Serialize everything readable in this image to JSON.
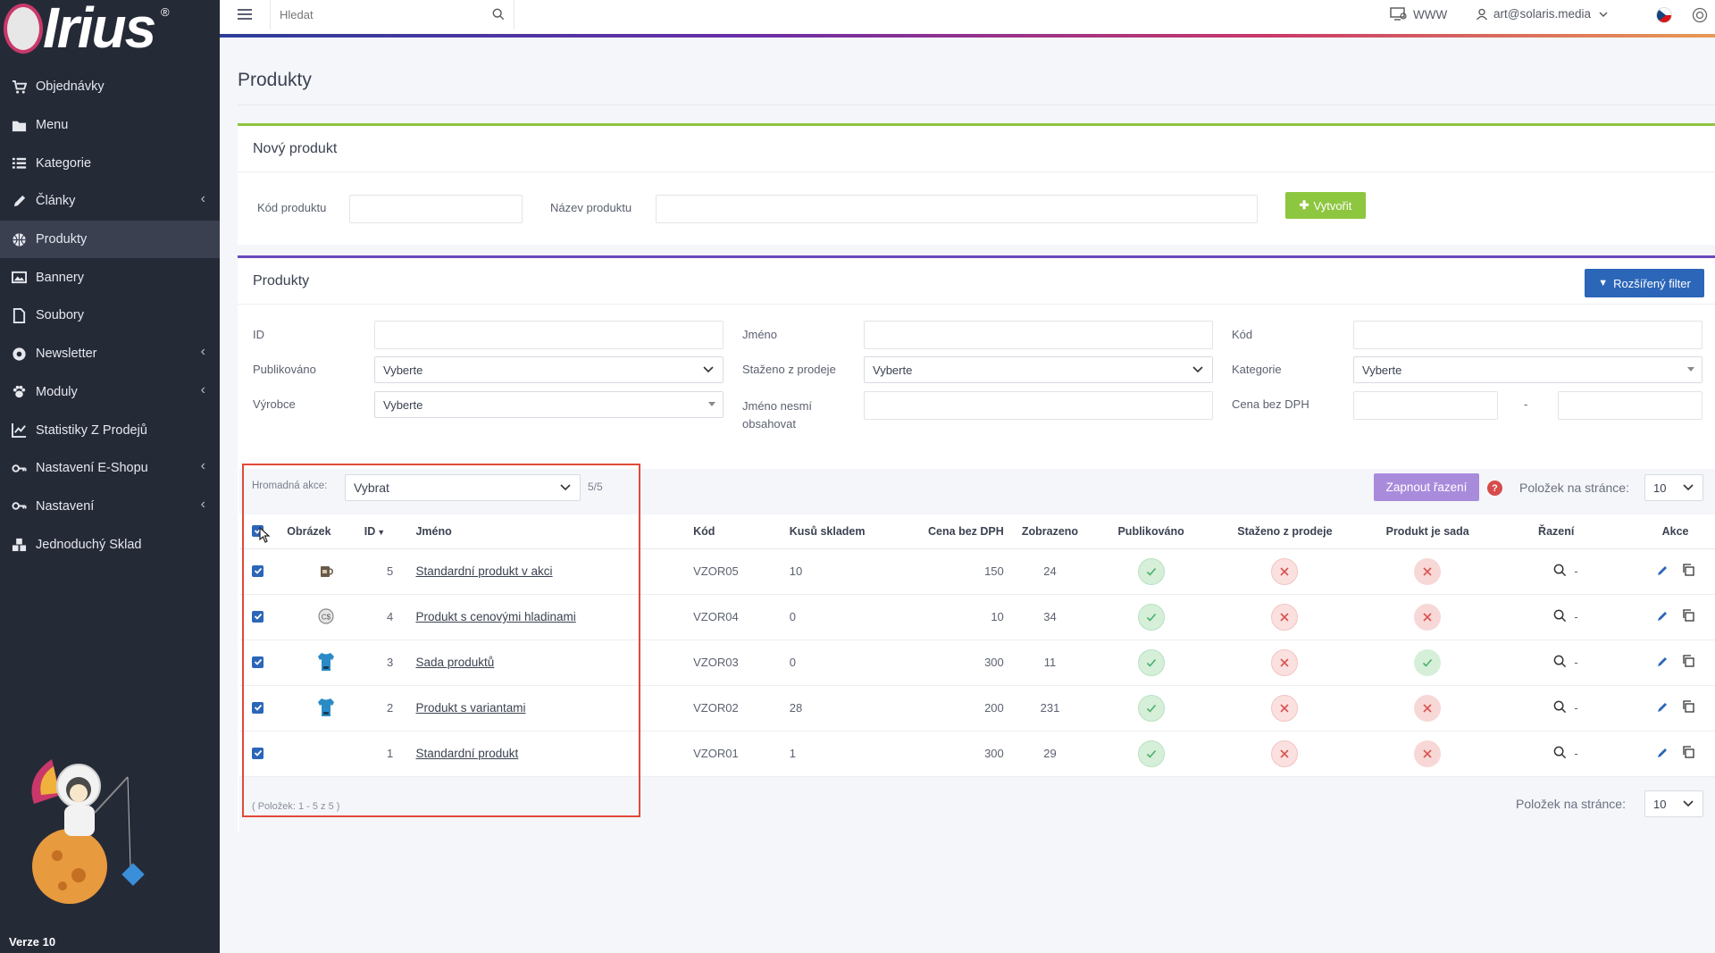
{
  "app": {
    "logo_text": "Irius",
    "version": "Verze 10"
  },
  "sidebar": {
    "items": [
      {
        "label": "Objednávky",
        "icon": "cart-icon",
        "arrow": false,
        "active": false
      },
      {
        "label": "Menu",
        "icon": "folder-icon",
        "arrow": false,
        "active": false
      },
      {
        "label": "Kategorie",
        "icon": "list-icon",
        "arrow": false,
        "active": false
      },
      {
        "label": "Články",
        "icon": "pencil-icon",
        "arrow": true,
        "active": false
      },
      {
        "label": "Produkty",
        "icon": "basketball-icon",
        "arrow": false,
        "active": true
      },
      {
        "label": "Bannery",
        "icon": "image-icon",
        "arrow": false,
        "active": false
      },
      {
        "label": "Soubory",
        "icon": "file-icon",
        "arrow": false,
        "active": false
      },
      {
        "label": "Newsletter",
        "icon": "at-icon",
        "arrow": true,
        "active": false
      },
      {
        "label": "Moduly",
        "icon": "paw-icon",
        "arrow": true,
        "active": false
      },
      {
        "label": "Statistiky Z Prodejů",
        "icon": "chart-line-icon",
        "arrow": false,
        "active": false
      },
      {
        "label": "Nastavení E-Shopu",
        "icon": "key-icon",
        "arrow": true,
        "active": false
      },
      {
        "label": "Nastavení",
        "icon": "key-icon",
        "arrow": true,
        "active": false
      },
      {
        "label": "Jednoduchý Sklad",
        "icon": "boxes-icon",
        "arrow": false,
        "active": false
      }
    ]
  },
  "topbar": {
    "search_placeholder": "Hledat",
    "www_label": "WWW",
    "user_email": "art@solaris.media"
  },
  "page": {
    "title": "Produkty"
  },
  "new_product": {
    "title": "Nový produkt",
    "code_label": "Kód produktu",
    "name_label": "Název produktu",
    "create_button": "Vytvořit"
  },
  "products": {
    "title": "Produkty",
    "filter_button": "Rozšířený filter",
    "filters": {
      "id_label": "ID",
      "name_label": "Jméno",
      "code_label": "Kód",
      "published_label": "Publikováno",
      "published_value": "Vyberte",
      "withdrawn_label": "Staženo z prodeje",
      "withdrawn_value": "Vyberte",
      "category_label": "Kategorie",
      "category_value": "Vyberte",
      "manufacturer_label": "Výrobce",
      "manufacturer_value": "Vyberte",
      "name_not_contain_label": "Jméno nesmí obsahovat",
      "price_label": "Cena bez DPH",
      "price_dash": "-"
    },
    "bulk_label": "Hromadná akce:",
    "bulk_value": "Vybrat",
    "selected_count": "5/5",
    "sort_button": "Zapnout řazení",
    "help_glyph": "?",
    "per_page_label": "Položek na stránce:",
    "per_page_value": "10",
    "footer": "( Položek: 1 - 5 z 5 )",
    "columns": {
      "image": "Obrázek",
      "id": "ID",
      "name": "Jméno",
      "code": "Kód",
      "stock": "Kusů skladem",
      "price": "Cena bez DPH",
      "views": "Zobrazeno",
      "published": "Publikováno",
      "withdrawn": "Staženo z prodeje",
      "is_set": "Produkt je sada",
      "sorting": "Řazení",
      "actions": "Akce"
    },
    "rows": [
      {
        "id": "5",
        "name": "Standardní produkt v akci",
        "code": "VZOR05",
        "stock": "10",
        "price": "150",
        "views": "24",
        "published": true,
        "withdrawn": false,
        "is_set": false,
        "sorting": "-",
        "thumb": "mug"
      },
      {
        "id": "4",
        "name": "Produkt s cenovými hladinami",
        "code": "VZOR04",
        "stock": "0",
        "price": "10",
        "views": "34",
        "published": true,
        "withdrawn": false,
        "is_set": false,
        "sorting": "-",
        "thumb": "coin"
      },
      {
        "id": "3",
        "name": "Sada produktů",
        "code": "VZOR03",
        "stock": "0",
        "price": "300",
        "views": "11",
        "published": true,
        "withdrawn": false,
        "is_set": true,
        "sorting": "-",
        "thumb": "shirt"
      },
      {
        "id": "2",
        "name": "Produkt s variantami",
        "code": "VZOR02",
        "stock": "28",
        "price": "200",
        "views": "231",
        "published": true,
        "withdrawn": false,
        "is_set": false,
        "sorting": "-",
        "thumb": "shirt"
      },
      {
        "id": "1",
        "name": "Standardní produkt",
        "code": "VZOR01",
        "stock": "1",
        "price": "300",
        "views": "29",
        "published": true,
        "withdrawn": false,
        "is_set": false,
        "sorting": "-",
        "thumb": "none"
      }
    ]
  },
  "colors": {
    "sidebar_bg": "#252a37",
    "accent_green": "#8dc63f",
    "accent_blue": "#2b66b8",
    "accent_purple": "#a98bdc",
    "highlight_red": "#e04a3a"
  }
}
